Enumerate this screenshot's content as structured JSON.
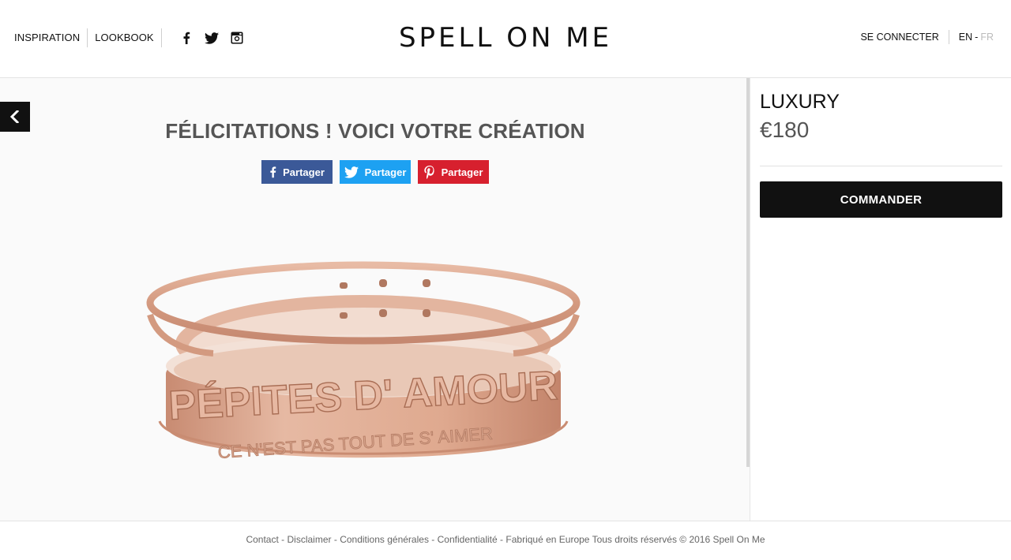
{
  "header": {
    "nav": [
      {
        "label": "INSPIRATION"
      },
      {
        "label": "LOOKBOOK"
      }
    ],
    "social": [
      "facebook-icon",
      "twitter-icon",
      "instagram-icon"
    ],
    "logo": "SPELL ON ME",
    "login_label": "SE CONNECTER",
    "lang": {
      "active": "EN",
      "separator": "-",
      "inactive": "FR"
    }
  },
  "main": {
    "headline": "FÉLICITATIONS ! VOICI VOTRE CRÉATION",
    "share_buttons": [
      {
        "label": "Partager",
        "network": "facebook",
        "color": "#3b5998"
      },
      {
        "label": "Partager",
        "network": "twitter",
        "color": "#1da1f2"
      },
      {
        "label": "Partager",
        "network": "pinterest",
        "color": "#d7202e"
      }
    ],
    "bracelet": {
      "top_text": "PÉPITES D' AMOUR",
      "bottom_text": "CE N'EST PAS TOUT DE S' AIMER"
    }
  },
  "side": {
    "product_name": "LUXURY",
    "price": "€180",
    "order_label": "COMMANDER"
  },
  "footer": {
    "links": [
      {
        "label": "Contact"
      },
      {
        "label": "Disclaimer"
      },
      {
        "label": "Conditions générales"
      },
      {
        "label": "Confidentialité"
      }
    ],
    "trailing_text": "Fabriqué en Europe Tous droits réservés © 2016 Spell On Me"
  },
  "colors": {
    "accent": "#111111",
    "facebook": "#3b5998",
    "twitter": "#1da1f2",
    "pinterest": "#d7202e",
    "rose_gold": "#d9a288"
  }
}
